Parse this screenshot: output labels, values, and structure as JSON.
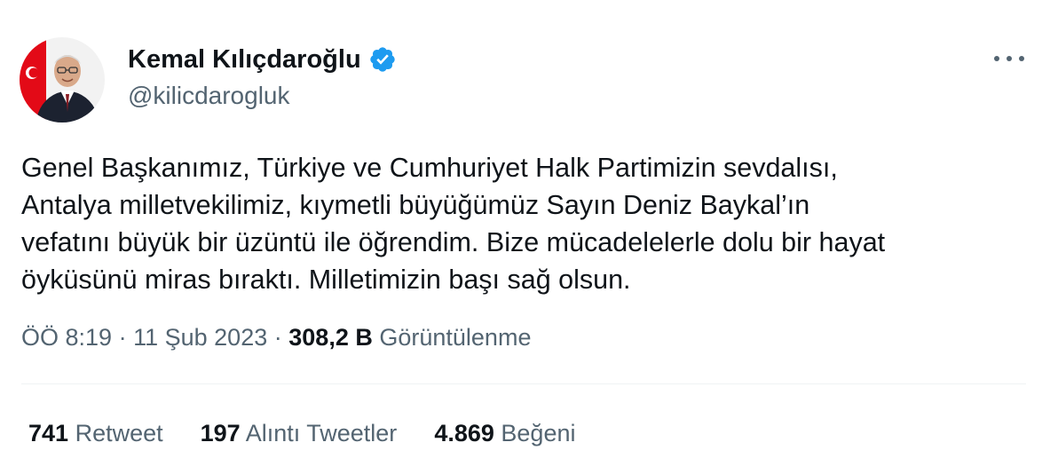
{
  "author": {
    "display_name": "Kemal Kılıçdaroğlu",
    "handle": "@kilicdarogluk",
    "verified_icon": "verified-badge-icon",
    "verified_color": "#1d9bf0"
  },
  "tweet": {
    "text": "Genel Başkanımız, Türkiye ve Cumhuriyet Halk Partimizin sevdalısı,\nAntalya milletvekilimiz, kıymetli büyüğümüz Sayın Deniz Baykal’ın\nvefatını büyük bir üzüntü ile öğrendim. Bize mücadelelerle dolu bir hayat\nöyküsünü miras bıraktı. Milletimizin başı sağ olsun.",
    "time": "ÖÖ 8:19",
    "separator": "·",
    "date": "11 Şub 2023",
    "views_count": "308,2 B",
    "views_label": "Görüntülenme"
  },
  "stats": [
    {
      "count": "741",
      "label": "Retweet"
    },
    {
      "count": "197",
      "label": "Alıntı Tweetler"
    },
    {
      "count": "4.869",
      "label": "Beğeni"
    }
  ],
  "colors": {
    "text_primary": "#0f1419",
    "text_secondary": "#536471",
    "divider": "#eff3f4"
  }
}
